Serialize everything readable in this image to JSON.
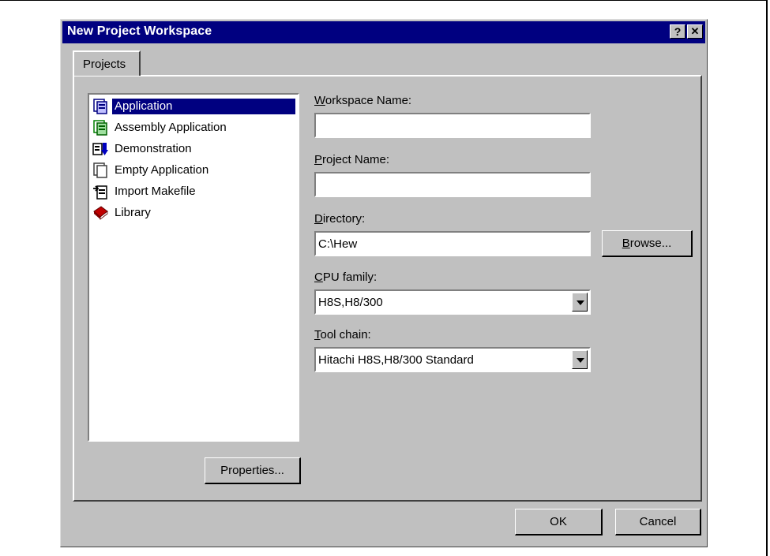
{
  "dialog": {
    "title": "New Project Workspace",
    "help_button": "?",
    "close_button": "✕"
  },
  "tabs": [
    {
      "label": "Projects"
    }
  ],
  "project_types": [
    {
      "label": "Application",
      "icon": "application-icon",
      "selected": true
    },
    {
      "label": "Assembly Application",
      "icon": "assembly-application-icon",
      "selected": false
    },
    {
      "label": "Demonstration",
      "icon": "demonstration-icon",
      "selected": false
    },
    {
      "label": "Empty Application",
      "icon": "empty-application-icon",
      "selected": false
    },
    {
      "label": "Import Makefile",
      "icon": "import-makefile-icon",
      "selected": false
    },
    {
      "label": "Library",
      "icon": "library-icon",
      "selected": false
    }
  ],
  "form": {
    "workspace_name": {
      "label_mnemonic": "W",
      "label_rest": "orkspace Name:",
      "value": ""
    },
    "project_name": {
      "label_mnemonic": "P",
      "label_rest": "roject Name:",
      "value": ""
    },
    "directory": {
      "label_mnemonic": "D",
      "label_rest": "irectory:",
      "value": "C:\\Hew"
    },
    "cpu_family": {
      "label_mnemonic": "C",
      "label_rest": "PU family:",
      "value": "H8S,H8/300"
    },
    "tool_chain": {
      "label_mnemonic": "T",
      "label_rest": "ool chain:",
      "value": "Hitachi H8S,H8/300 Standard"
    }
  },
  "buttons": {
    "browse_mnemonic": "B",
    "browse_rest": "rowse...",
    "properties": "Properties...",
    "ok": "OK",
    "cancel": "Cancel"
  },
  "colors": {
    "titlebar": "#000080",
    "dialog_face": "#c0c0c0",
    "selection": "#000080"
  }
}
